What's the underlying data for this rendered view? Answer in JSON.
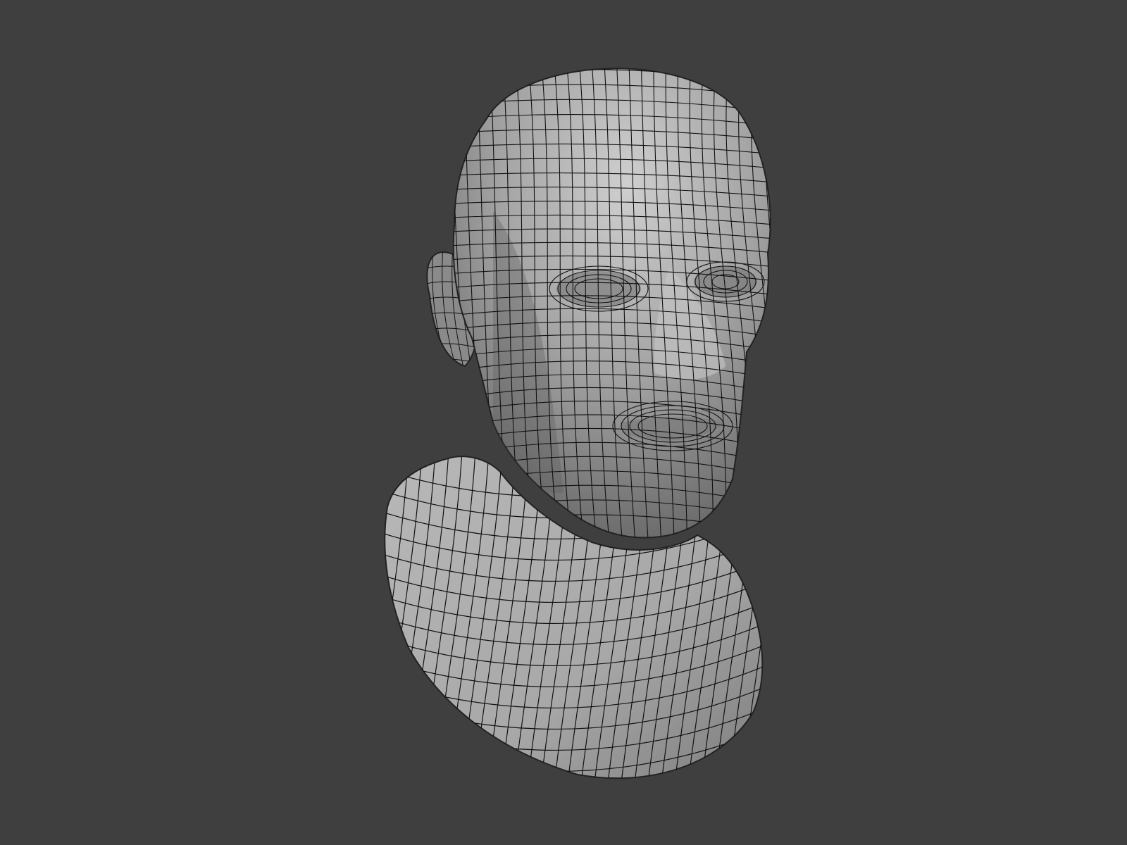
{
  "viewport": {
    "background_color": "#3f3f3f"
  },
  "model": {
    "subject": "head-bust-wireframe",
    "surface_color": "#9b9b9b",
    "highlight_color": "#c8c8c8",
    "shadow_color": "#555555",
    "wire_color": "#111111"
  }
}
